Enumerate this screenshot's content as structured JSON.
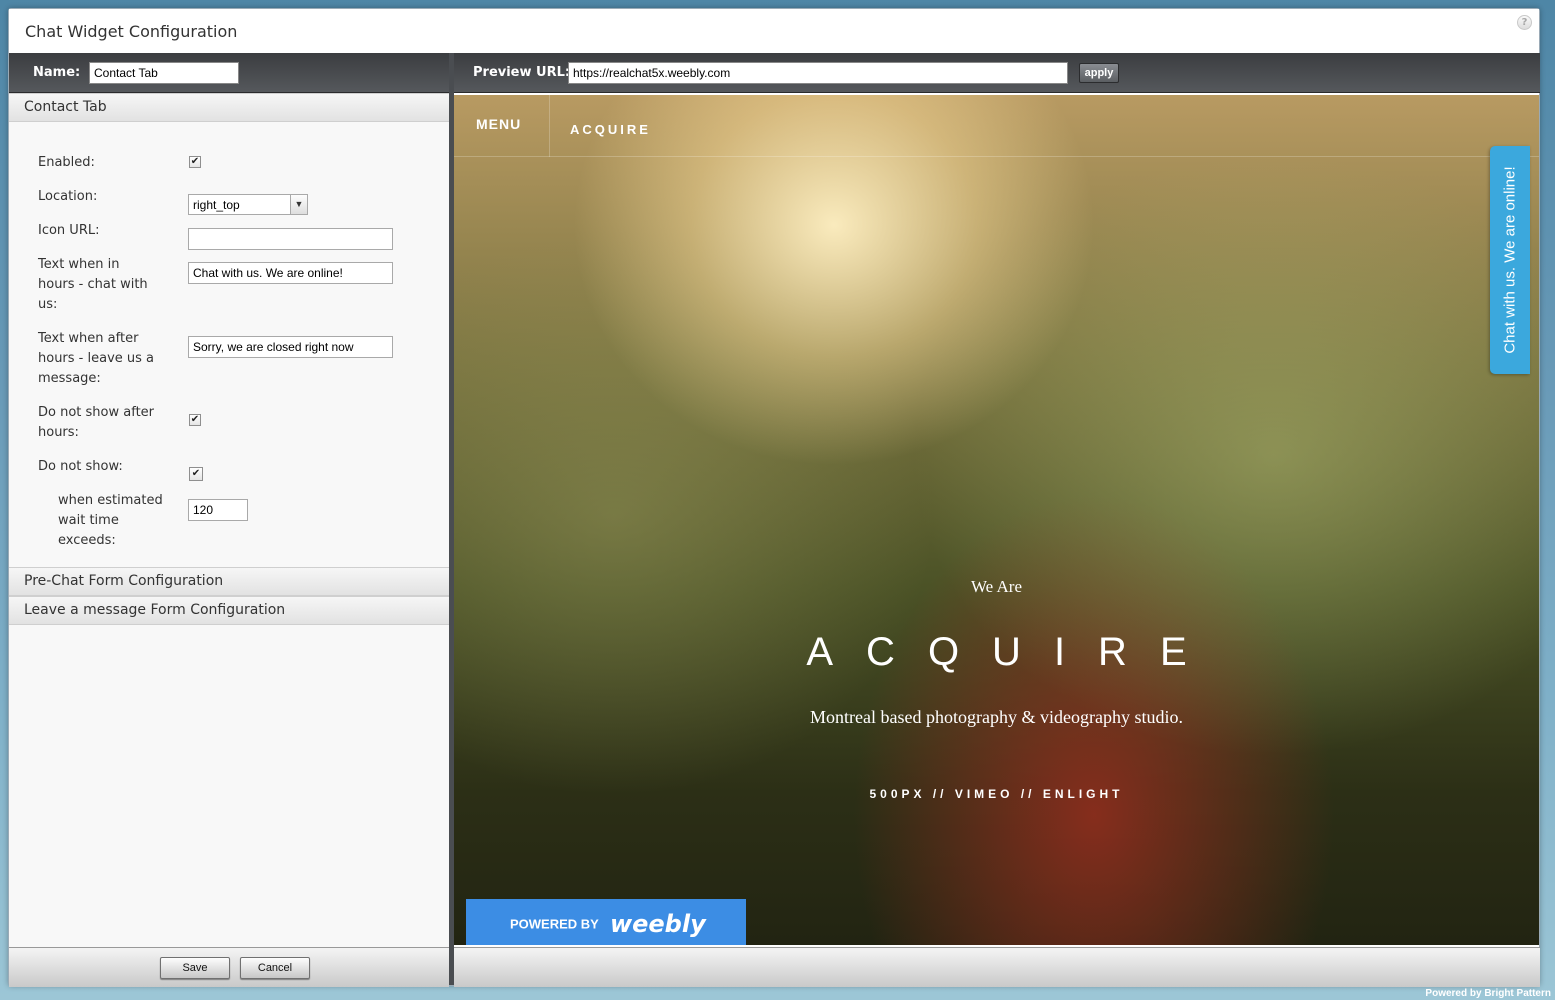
{
  "window": {
    "title": "Chat Widget Configuration",
    "help_glyph": "?"
  },
  "left_toolbar": {
    "name_label": "Name:",
    "name_value": "Contact Tab"
  },
  "right_toolbar": {
    "preview_label": "Preview URL:",
    "preview_url": "https://realchat5x.weebly.com",
    "apply_label": "apply"
  },
  "contact_tab": {
    "header": "Contact Tab",
    "enabled_label": "Enabled:",
    "enabled": true,
    "location_label": "Location:",
    "location_value": "right_top",
    "icon_url_label": "Icon URL:",
    "icon_url_value": "",
    "text_in_hours_label": "Text when in hours - chat with us:",
    "text_in_hours_value": "Chat with us. We are online!",
    "text_after_hours_label": "Text when after hours - leave us a message:",
    "text_after_hours_value": "Sorry, we are closed right now",
    "do_not_show_after_label": "Do not show after hours:",
    "do_not_show_after": true,
    "do_not_show_label": "Do not show:",
    "do_not_show": true,
    "wait_time_label": "when estimated wait time exceeds:",
    "wait_time_value": "120"
  },
  "sections": {
    "prechat": "Pre-Chat Form Configuration",
    "leave_message": "Leave a message Form Configuration"
  },
  "buttons": {
    "save": "Save",
    "cancel": "Cancel"
  },
  "preview": {
    "menu": "MENU",
    "brand": "ACQUIRE",
    "we_are": "We Are",
    "title": "ACQUIRE",
    "tagline": "Montreal based photography & videography studio.",
    "links": "500PX  //  VIMEO  //  ENLIGHT",
    "weebly_powered": "POWERED BY",
    "weebly_logo": "weebly",
    "chat_tab_text": "Chat with us. We are online!",
    "chat_tab_color": "#3ba8dd"
  },
  "footer": {
    "powered_by": "Powered by Bright Pattern"
  }
}
